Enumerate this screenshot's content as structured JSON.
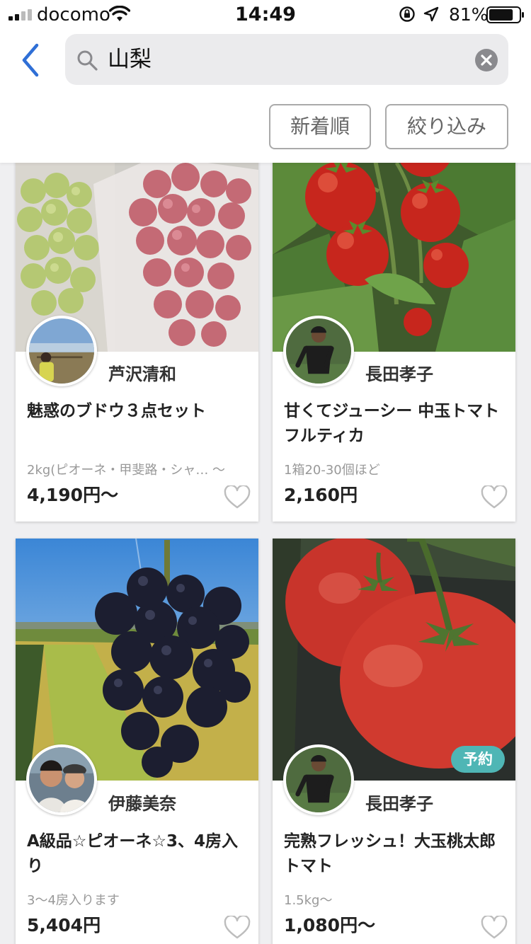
{
  "status_bar": {
    "carrier": "docomo",
    "time": "14:49",
    "battery_percent": "81%",
    "battery_level": 0.81,
    "icons": [
      "signal-icon",
      "wifi-icon",
      "rotation-lock-icon",
      "location-arrow-icon",
      "battery-icon"
    ]
  },
  "header": {
    "search_query": "山梨",
    "sort_label": "新着順",
    "filter_label": "絞り込み",
    "icons": [
      "back-chevron-icon",
      "search-icon",
      "clear-icon"
    ]
  },
  "colors": {
    "accent_blue": "#2f6fd6",
    "badge_teal": "#4fb6b5",
    "background": "#efeff1"
  },
  "products": [
    {
      "producer": "芦沢清和",
      "name": "魅惑のブドウ３点セット",
      "description": "2kg(ピオーネ・甲斐路・シャ…  ～",
      "price": "4,190円〜",
      "photo": "grapes-in-bags",
      "favorite": false
    },
    {
      "producer": "長田孝子",
      "name": "甘くてジューシー 中玉トマト フルティカ",
      "description": "1箱20-30個ほど",
      "price": "2,160円",
      "photo": "cherry-tomatoes-on-vine",
      "favorite": false
    },
    {
      "producer": "伊藤美奈",
      "name": "A級品☆ピオーネ☆3、4房入り",
      "description": "3〜4房入ります",
      "price": "5,404円",
      "photo": "black-grape-bunch",
      "favorite": false
    },
    {
      "producer": "長田孝子",
      "name": "完熟フレッシュ！大玉桃太郎トマト",
      "description": "1.5kg〜",
      "price": "1,080円〜",
      "photo": "large-red-tomatoes",
      "badge": "予約",
      "favorite": false
    }
  ]
}
